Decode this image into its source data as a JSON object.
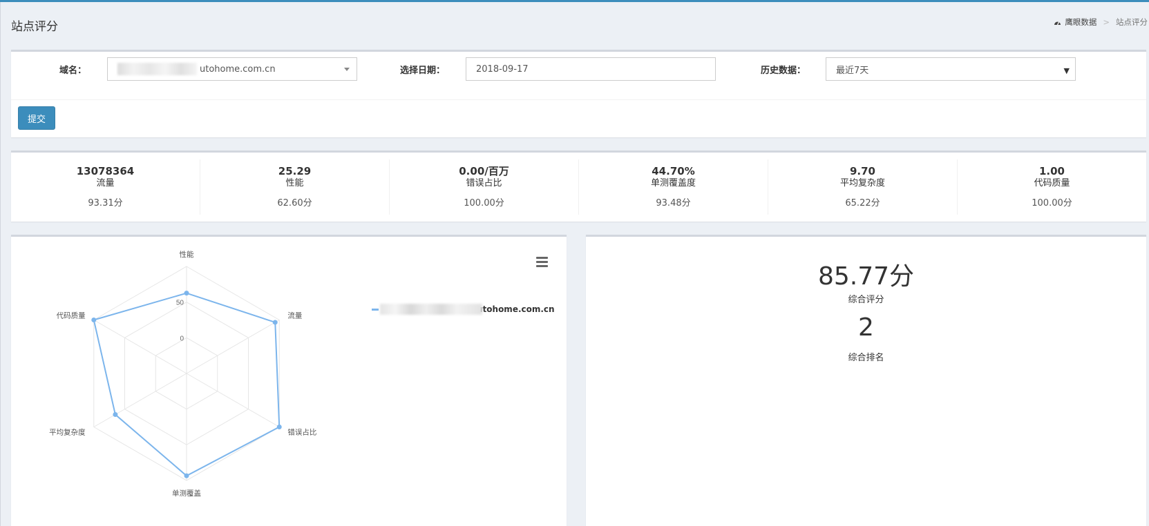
{
  "page": {
    "title": "站点评分",
    "breadcrumb": [
      "鹰眼数据",
      "站点评分"
    ]
  },
  "form": {
    "domain_label": "域名：",
    "domain_value": "utohome.com.cn",
    "date_label": "选择日期：",
    "date_value": "2018-09-17",
    "history_label": "历史数据：",
    "history_value": "最近7天",
    "submit_label": "提交"
  },
  "stats": [
    {
      "value": "13078364",
      "name": "流量",
      "score": "93.31分"
    },
    {
      "value": "25.29",
      "name": "性能",
      "score": "62.60分"
    },
    {
      "value": "0.00/百万",
      "name": "错误占比",
      "score": "100.00分"
    },
    {
      "value": "44.70%",
      "name": "单测覆盖度",
      "score": "93.48分"
    },
    {
      "value": "9.70",
      "name": "平均复杂度",
      "score": "65.22分"
    },
    {
      "value": "1.00",
      "name": "代码质量",
      "score": "100.00分"
    }
  ],
  "summary": {
    "total_score": "85.77分",
    "total_score_label": "综合评分",
    "rank": "2",
    "rank_label": "综合排名"
  },
  "colors": {
    "accent": "#3c8dbc",
    "series": "#7cb5ec"
  },
  "chart_data": {
    "type": "radar",
    "categories": [
      "性能",
      "流量",
      "错误占比",
      "单测覆盖",
      "平均复杂度",
      "代码质量"
    ],
    "series": [
      {
        "name": "utohome.com.cn",
        "values": [
          62.6,
          93.31,
          100,
          93.48,
          65.22,
          100
        ]
      }
    ],
    "tick_labels": [
      "0",
      "50"
    ],
    "ylim": [
      -50,
      100
    ],
    "grid": true,
    "legend": "right"
  }
}
